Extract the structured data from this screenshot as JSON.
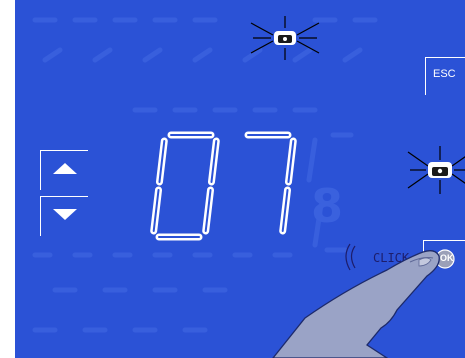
{
  "display": {
    "value": "07",
    "background_color": "#2b52d6",
    "segment_color": "#ffffff"
  },
  "buttons": {
    "esc_label": "ESC",
    "ok_label": "OK",
    "up_icon": "triangle-up-icon",
    "down_icon": "triangle-down-icon"
  },
  "indicators": {
    "top_phone": "phone-icon-blinking",
    "right_phone": "phone-icon-blinking"
  },
  "annotation": {
    "click_text": "CLICK"
  }
}
